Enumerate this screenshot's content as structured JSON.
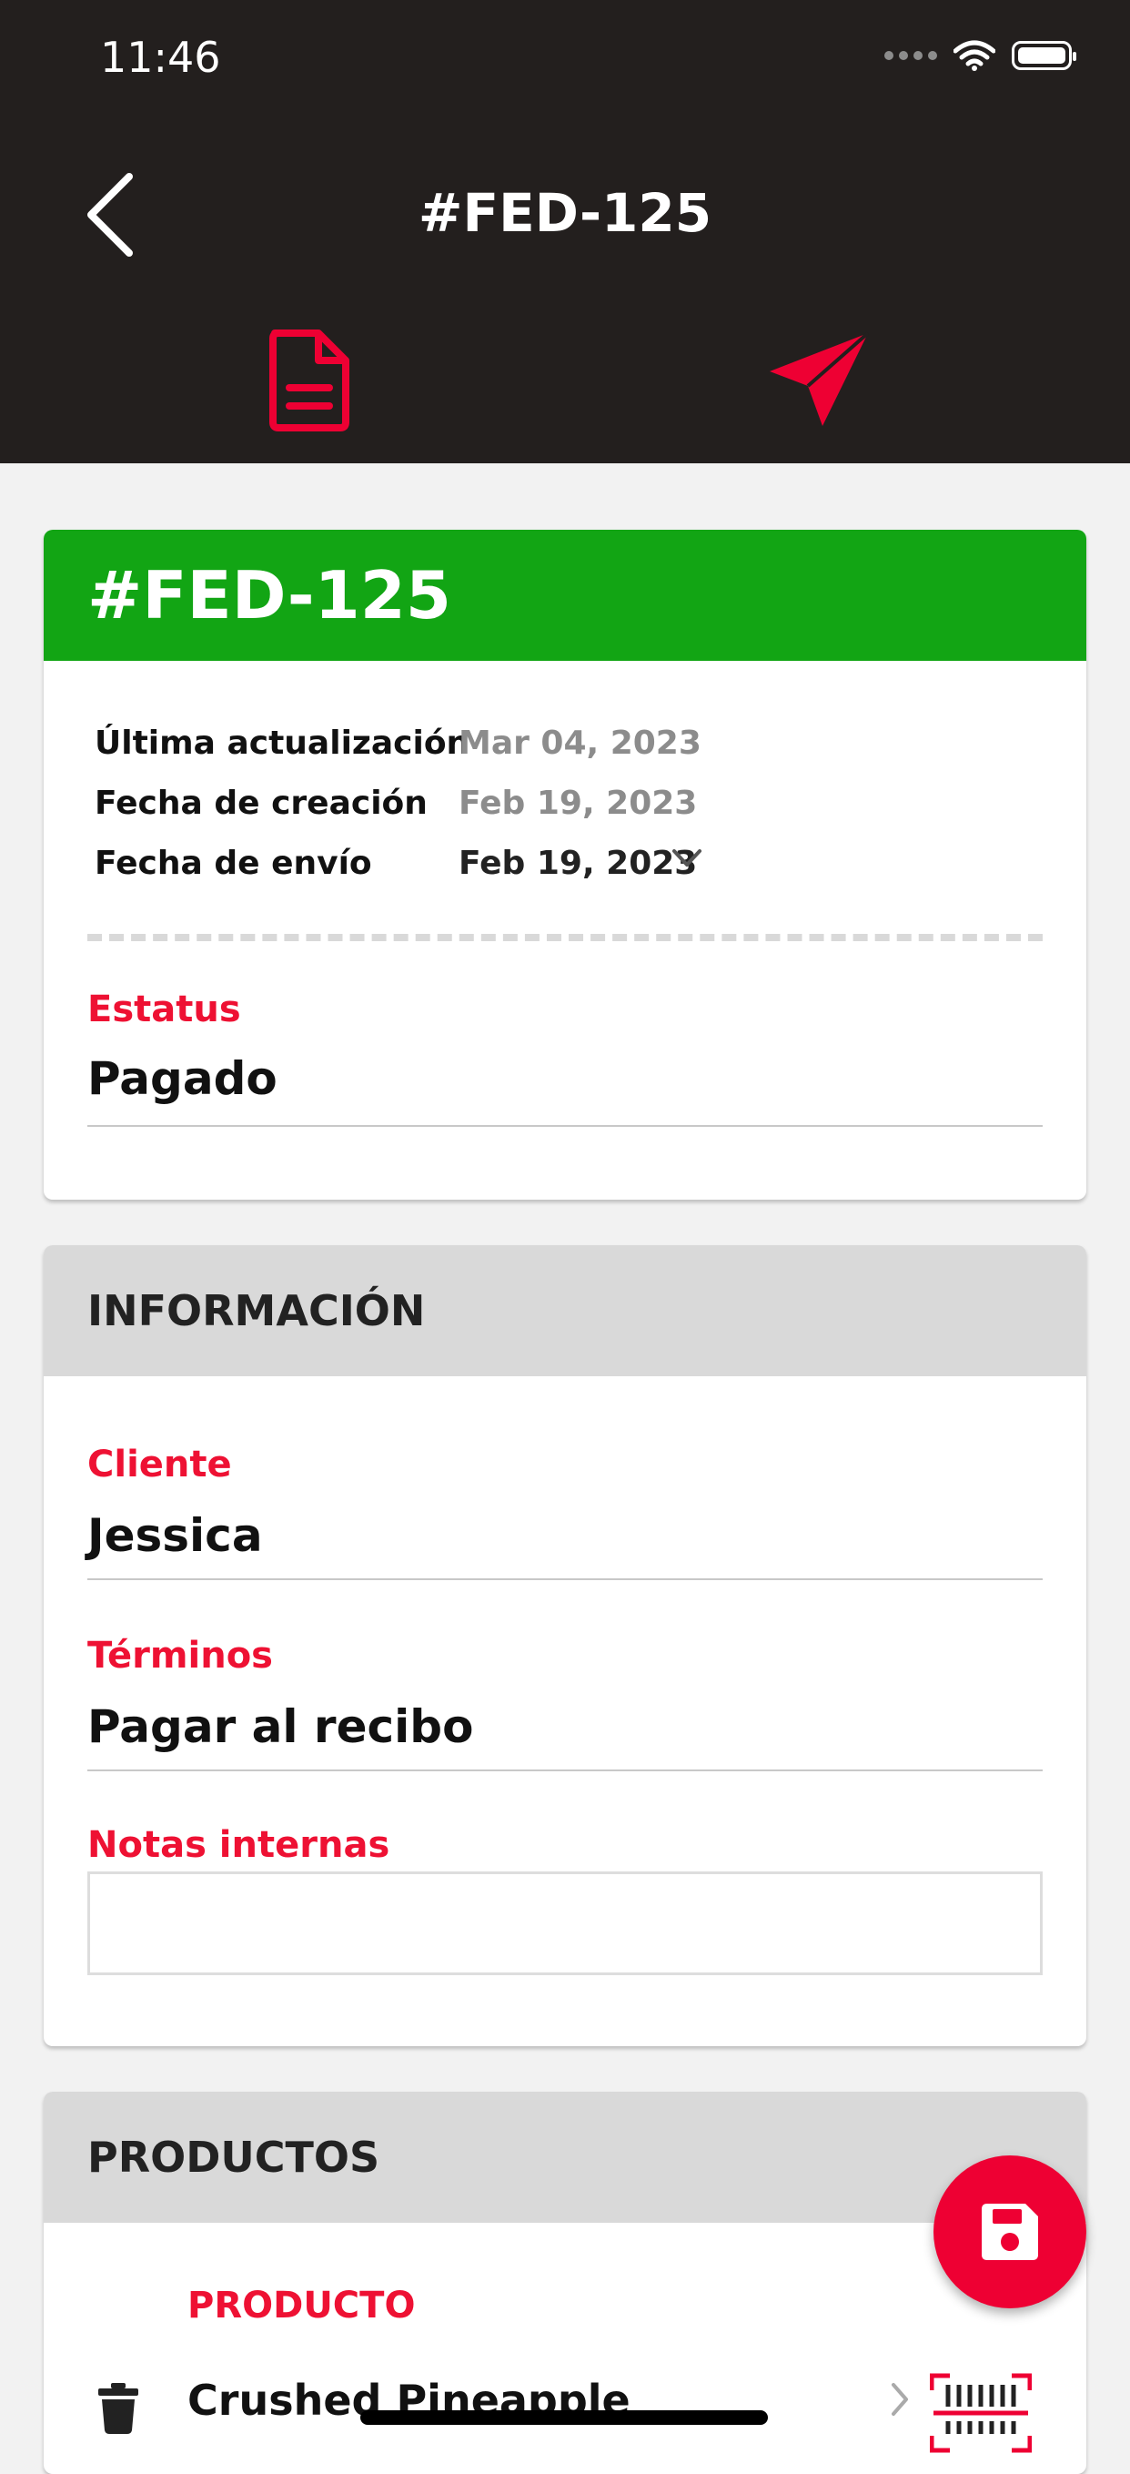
{
  "status_bar": {
    "time": "11:46"
  },
  "header": {
    "title": "#FED-125"
  },
  "summary": {
    "code": "#FED-125",
    "rows": [
      {
        "label": "Última actualización",
        "value": "Mar 04, 2023"
      },
      {
        "label": "Fecha de creación",
        "value": "Feb 19, 2023"
      },
      {
        "label": "Fecha de envío",
        "value": "Feb 19, 2023"
      }
    ],
    "status_label": "Estatus",
    "status_value": "Pagado"
  },
  "info": {
    "heading": "INFORMACIÓN",
    "client_label": "Cliente",
    "client_value": "Jessica",
    "terms_label": "Términos",
    "terms_value": "Pagar al recibo",
    "notes_label": "Notas internas",
    "notes_value": ""
  },
  "products": {
    "heading": "PRODUCTOS",
    "column_label": "PRODUCTO",
    "items": [
      {
        "name": "Crushed Pineapple"
      }
    ]
  },
  "colors": {
    "accent": "#ee1133",
    "header_bg": "#231f1e",
    "order_banner": "#12a514"
  }
}
